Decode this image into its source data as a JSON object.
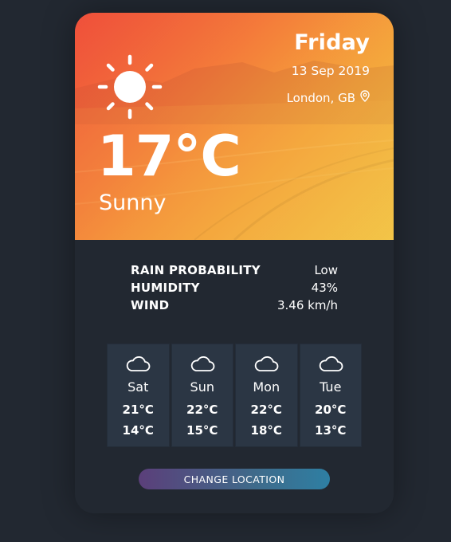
{
  "header": {
    "day": "Friday",
    "date": "13 Sep 2019",
    "location": "London, GB",
    "location_icon": "map-pin-icon"
  },
  "current": {
    "temperature": "17°C",
    "condition": "Sunny",
    "icon": "sun-icon"
  },
  "details": [
    {
      "label": "RAIN PROBABILITY",
      "value": "Low"
    },
    {
      "label": "HUMIDITY",
      "value": "43%"
    },
    {
      "label": "WIND",
      "value": "3.46 km/h"
    }
  ],
  "forecast": [
    {
      "day": "Sat",
      "high": "21°C",
      "low": "14°C",
      "icon": "cloud-icon"
    },
    {
      "day": "Sun",
      "high": "22°C",
      "low": "15°C",
      "icon": "cloud-icon"
    },
    {
      "day": "Mon",
      "high": "22°C",
      "low": "18°C",
      "icon": "cloud-icon"
    },
    {
      "day": "Tue",
      "high": "20°C",
      "low": "13°C",
      "icon": "cloud-icon"
    }
  ],
  "button": {
    "label": "CHANGE LOCATION"
  },
  "colors": {
    "background": "#222831",
    "tile": "#2b3644",
    "hero_start": "#f0533e",
    "hero_end": "#f2c84a",
    "button_start": "#5b3f7a",
    "button_end": "#2e7fa3"
  }
}
